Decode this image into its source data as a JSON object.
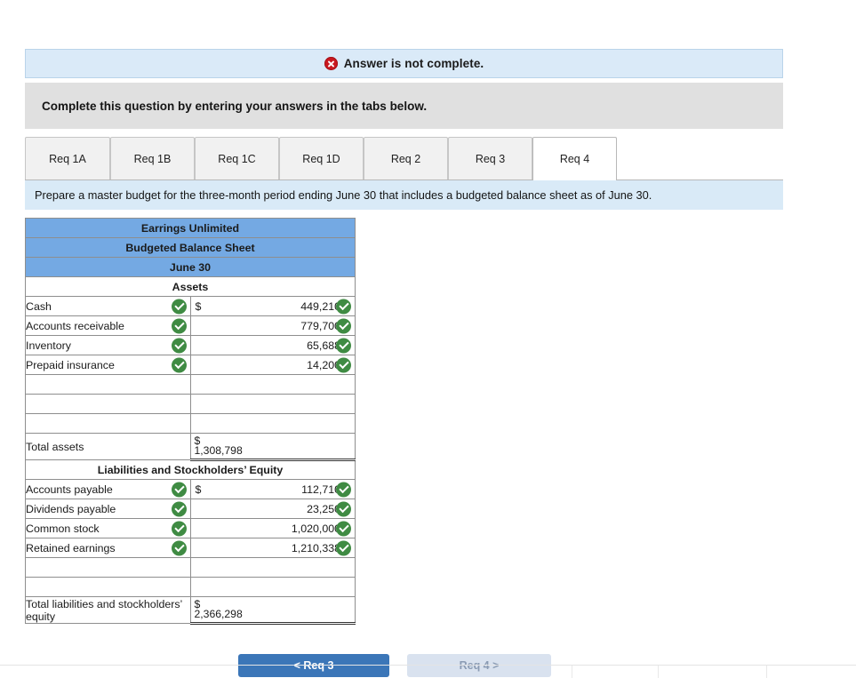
{
  "alert": {
    "icon": "error-x-icon",
    "text": "Answer is not complete."
  },
  "instruction_band": {
    "text": "Complete this question by entering your answers in the tabs below."
  },
  "tabs": [
    {
      "label": "Req 1A",
      "active": false
    },
    {
      "label": "Req 1B",
      "active": false
    },
    {
      "label": "Req 1C",
      "active": false
    },
    {
      "label": "Req 1D",
      "active": false
    },
    {
      "label": "Req 2",
      "active": false
    },
    {
      "label": "Req 3",
      "active": false
    },
    {
      "label": "Req 4",
      "active": true
    }
  ],
  "requirement_strip": {
    "text": "Prepare a master budget for the three-month period ending June 30 that includes a budgeted balance sheet as of June 30."
  },
  "balance_sheet": {
    "company": "Earrings Unlimited",
    "statement": "Budgeted Balance Sheet",
    "date": "June 30",
    "assets_heading": "Assets",
    "asset_rows": [
      {
        "label": "Cash",
        "currency": "$",
        "value": "449,210",
        "label_check": true,
        "value_check": true
      },
      {
        "label": "Accounts receivable",
        "currency": "",
        "value": "779,700",
        "label_check": true,
        "value_check": true
      },
      {
        "label": "Inventory",
        "currency": "",
        "value": "65,688",
        "label_check": true,
        "value_check": true
      },
      {
        "label": "Prepaid insurance",
        "currency": "",
        "value": "14,200",
        "label_check": true,
        "value_check": true
      }
    ],
    "asset_blank_rows": 3,
    "total_assets": {
      "label": "Total assets",
      "currency": "$",
      "value": "1,308,798"
    },
    "equity_heading": "Liabilities and Stockholders’ Equity",
    "equity_rows": [
      {
        "label": "Accounts payable",
        "currency": "$",
        "value": "112,710",
        "label_check": true,
        "value_check": true
      },
      {
        "label": "Dividends payable",
        "currency": "",
        "value": "23,250",
        "label_check": true,
        "value_check": true
      },
      {
        "label": "Common stock",
        "currency": "",
        "value": "1,020,000",
        "label_check": true,
        "value_check": true
      },
      {
        "label": "Retained earnings",
        "currency": "",
        "value": "1,210,338",
        "label_check": true,
        "value_check": true
      }
    ],
    "equity_blank_rows": 2,
    "total_equity": {
      "label": "Total liabilities and stockholders’ equity",
      "currency": "$",
      "value": "2,366,298"
    }
  },
  "footer_buttons": {
    "prev_label": "< Req 3",
    "next_label": "Req 4 >"
  },
  "colors": {
    "header_blue": "#74a9e3",
    "alert_blue": "#daeaf8",
    "strip_blue": "#d9eaf7",
    "band_grey": "#e0e0e0",
    "check_green": "#3f8b43",
    "error_red": "#c9181f",
    "primary_button": "#3b76b8"
  }
}
